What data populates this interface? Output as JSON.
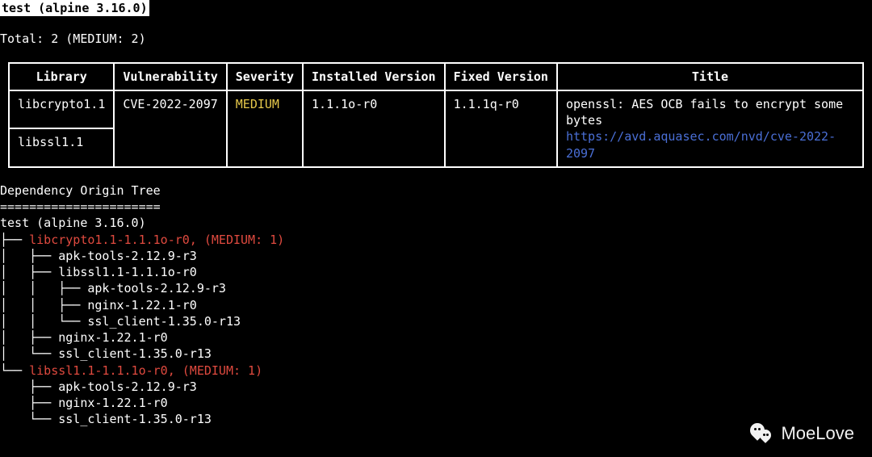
{
  "header": "test (alpine 3.16.0)",
  "total_line": "Total: 2 (MEDIUM: 2)",
  "table": {
    "columns": [
      "Library",
      "Vulnerability",
      "Severity",
      "Installed Version",
      "Fixed Version",
      "Title"
    ],
    "rows": [
      {
        "library": "libcrypto1.1",
        "vulnerability": "CVE-2022-2097",
        "severity": "MEDIUM",
        "installed": "1.1.1o-r0",
        "fixed": "1.1.1q-r0",
        "title": "openssl: AES OCB fails to encrypt some bytes",
        "link": "https://avd.aquasec.com/nvd/cve-2022-2097"
      },
      {
        "library": "libssl1.1"
      }
    ]
  },
  "tree": {
    "title": "Dependency Origin Tree",
    "divider": "======================",
    "root": "test (alpine 3.16.0)",
    "node1": "libcrypto1.1-1.1.1o-r0, (MEDIUM: 1)",
    "n1a": "apk-tools-2.12.9-r3",
    "n1b": "libssl1.1-1.1.1o-r0",
    "n1b1": "apk-tools-2.12.9-r3",
    "n1b2": "nginx-1.22.1-r0",
    "n1b3": "ssl_client-1.35.0-r13",
    "n1c": "nginx-1.22.1-r0",
    "n1d": "ssl_client-1.35.0-r13",
    "node2": "libssl1.1-1.1.1o-r0, (MEDIUM: 1)",
    "n2a": "apk-tools-2.12.9-r3",
    "n2b": "nginx-1.22.1-r0",
    "n2c": "ssl_client-1.35.0-r13"
  },
  "watermark": "MoeLove"
}
